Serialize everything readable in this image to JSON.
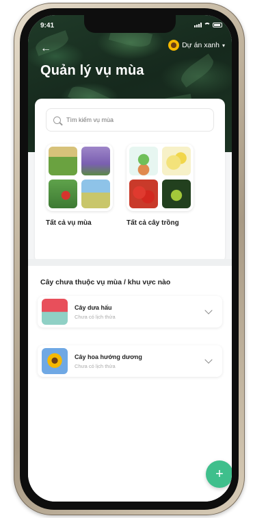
{
  "status": {
    "time": "9:41"
  },
  "header": {
    "title": "Quản lý vụ mùa",
    "project": "Dự án xanh"
  },
  "search": {
    "placeholder": "Tìm kiếm vụ mùa"
  },
  "categories": [
    {
      "label": "Tất cả vụ mùa"
    },
    {
      "label": "Tất cả cây trồng"
    }
  ],
  "section": {
    "title": "Cây chưa thuộc vụ mùa / khu vực nào",
    "items": [
      {
        "name": "Cây dưa hấu",
        "subtitle": "Chưa có lịch thửa"
      },
      {
        "name": "Cây hoa hướng dương",
        "subtitle": "Chưa có lịch thửa"
      }
    ]
  },
  "fab": {
    "label": "+"
  },
  "colors": {
    "accent": "#3fbf8c",
    "header_dark": "#1f3a28"
  },
  "icons": [
    "back-arrow-icon",
    "sunflower-icon",
    "dropdown-caret-icon",
    "search-icon",
    "chevron-down-icon",
    "plus-icon"
  ]
}
